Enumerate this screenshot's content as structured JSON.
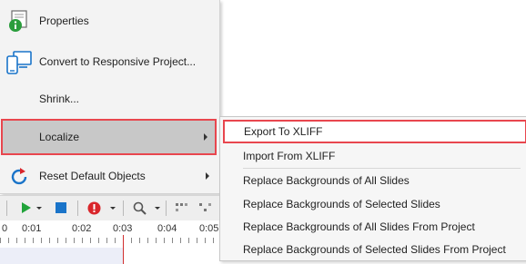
{
  "main_menu": {
    "items": [
      {
        "label": "Properties",
        "icon": "info-icon"
      },
      {
        "label": "Convert to Responsive Project...",
        "icon": "responsive-devices-icon"
      },
      {
        "label": "Shrink...",
        "icon": ""
      },
      {
        "label": "Localize",
        "icon": "",
        "submenu": true,
        "state": "highlighted"
      },
      {
        "label": "Reset Default Objects",
        "icon": "reset-icon",
        "submenu": true
      }
    ]
  },
  "localize_submenu": {
    "items": [
      {
        "label": "Export To XLIFF",
        "state": "highlighted"
      },
      {
        "label": "Import From XLIFF"
      },
      {
        "label": "Replace Backgrounds of All Slides"
      },
      {
        "label": "Replace Backgrounds of Selected Slides"
      },
      {
        "label": "Replace Backgrounds of All Slides From Project"
      },
      {
        "label": "Replace Backgrounds of Selected Slides From Project"
      }
    ]
  },
  "timeline": {
    "ticks": [
      "0",
      "0:01",
      "0:02",
      "0:03",
      "0:04",
      "0:05"
    ]
  },
  "colors": {
    "highlight_border": "#e8464e",
    "hover_background": "#c8c8c8",
    "info_icon": "#2a9d3c",
    "device_icon": "#1a74c9",
    "play_icon": "#21a33a",
    "stop_icon": "#1a74c9",
    "record_icon": "#d9262b",
    "playhead": "#d12f2f"
  }
}
